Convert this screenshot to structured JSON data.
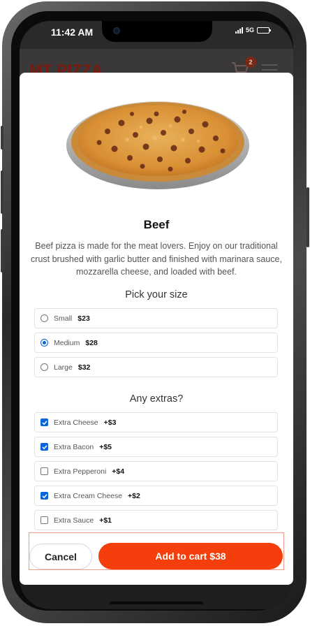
{
  "status_bar": {
    "time": "11:42 AM",
    "network": "5G"
  },
  "header": {
    "brand": "MT PIZZA",
    "cart_count": "2"
  },
  "product": {
    "name": "Beef",
    "description": "Beef pizza is made for the meat lovers. Enjoy on our traditional crust brushed with garlic butter and finished with marinara sauce, mozzarella cheese, and loaded with beef."
  },
  "sizes": {
    "title": "Pick your size",
    "options": [
      {
        "label": "Small",
        "price": "$23",
        "selected": false
      },
      {
        "label": "Medium",
        "price": "$28",
        "selected": true
      },
      {
        "label": "Large",
        "price": "$32",
        "selected": false
      }
    ]
  },
  "extras": {
    "title": "Any extras?",
    "options": [
      {
        "label": "Extra Cheese",
        "price": "+$3",
        "checked": true
      },
      {
        "label": "Extra Bacon",
        "price": "+$5",
        "checked": true
      },
      {
        "label": "Extra Pepperoni",
        "price": "+$4",
        "checked": false
      },
      {
        "label": "Extra Cream Cheese",
        "price": "+$2",
        "checked": true
      },
      {
        "label": "Extra Sauce",
        "price": "+$1",
        "checked": false
      }
    ]
  },
  "actions": {
    "cancel_label": "Cancel",
    "add_label": "Add to cart $38"
  },
  "colors": {
    "accent": "#f43e0c",
    "control_blue": "#0a63d8",
    "brand_red": "#b72a12"
  },
  "icons": [
    "camera-icon",
    "signal-icon",
    "battery-icon",
    "cart-icon",
    "menu-icon",
    "checkmark-icon"
  ]
}
